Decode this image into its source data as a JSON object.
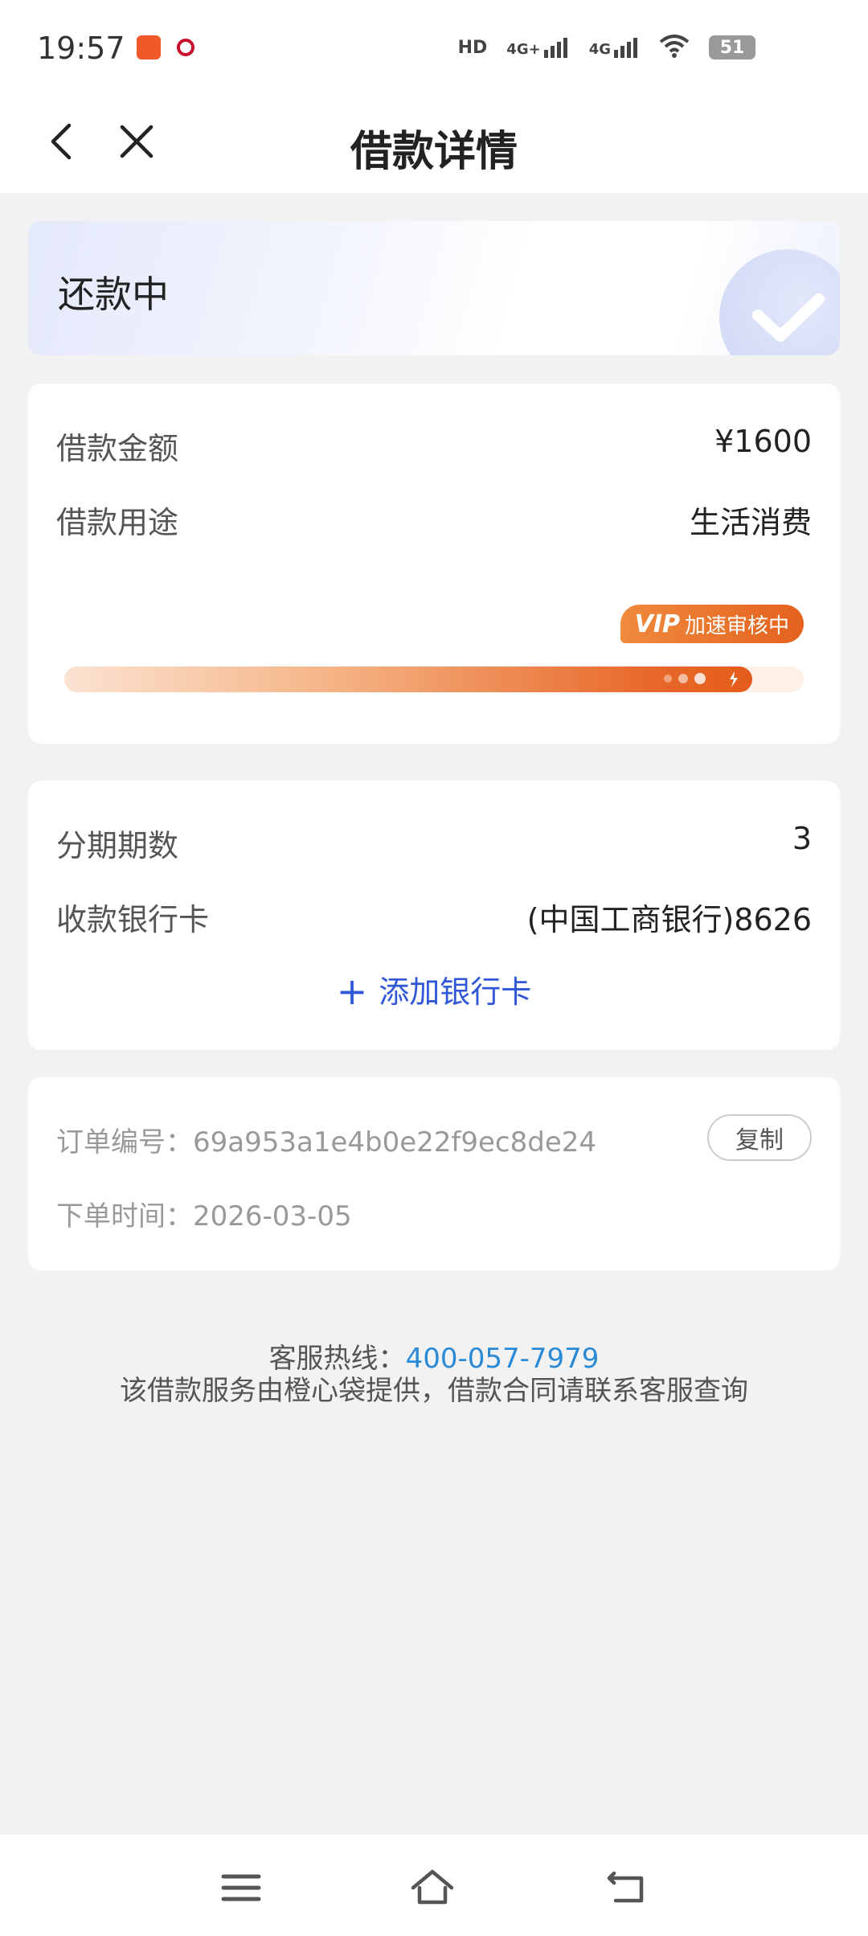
{
  "status_bar": {
    "time": "19:57",
    "hd_tag": "HD",
    "sim1_tag": "4G+",
    "sim2_tag": "4G",
    "battery": "51"
  },
  "nav": {
    "title": "借款详情",
    "back_icon": "chevron-left-icon",
    "close_icon": "close-icon"
  },
  "status_card": {
    "label": "还款中",
    "icon": "check-icon"
  },
  "loan_card": {
    "amount_label": "借款金额",
    "amount_value": "¥1600",
    "purpose_label": "借款用途",
    "purpose_value": "生活消费",
    "vip_tag": "VIP",
    "vip_text": "加速审核中",
    "progress_fraction": 0.93
  },
  "installment_card": {
    "period_label": "分期期数",
    "period_value": "3",
    "bank_label": "收款银行卡",
    "bank_value": "(中国工商银行)8626",
    "add_card_label": "添加银行卡"
  },
  "order_card": {
    "order_no_label": "订单编号：",
    "order_no_value": "69a953a1e4b0e22f9ec8de24",
    "copy_label": "复制",
    "order_time_label": "下单时间：",
    "order_time_value": "2026-03-05"
  },
  "footer": {
    "hotline_label": "客服热线：",
    "hotline_number": "400-057-7979",
    "disclaimer": "该借款服务由橙心袋提供，借款合同请联系客服查询"
  },
  "colors": {
    "accent_blue": "#2f57d6",
    "link_blue": "#2a8ad6",
    "vip_orange": "#e4621e"
  }
}
